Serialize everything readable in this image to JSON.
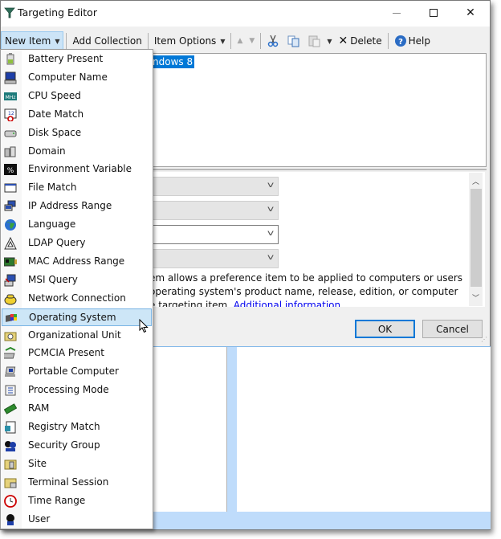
{
  "window": {
    "title": "Targeting Editor",
    "controls": {
      "minimize": "minimize",
      "maximize": "maximize",
      "close": "close"
    }
  },
  "toolbar": {
    "new_item": "New Item",
    "add_collection": "Add Collection",
    "item_options": "Item Options",
    "delete": "Delete",
    "help": "Help"
  },
  "tree": {
    "selected_item_visible_text": "ndows 8"
  },
  "properties": {
    "description_lines": [
      "em allows a preference item to be applied to computers or users",
      " operating system's product name, release, edition, or computer",
      "e targeting item. "
    ],
    "link_text": "Additional information"
  },
  "buttons": {
    "ok": "OK",
    "cancel": "Cancel"
  },
  "menu": {
    "hovered_index": 14,
    "items": [
      {
        "label": "Battery Present",
        "icon": "battery-icon"
      },
      {
        "label": "Computer Name",
        "icon": "computer-icon"
      },
      {
        "label": "CPU Speed",
        "icon": "mhz-icon"
      },
      {
        "label": "Date Match",
        "icon": "calendar-icon"
      },
      {
        "label": "Disk Space",
        "icon": "disk-icon"
      },
      {
        "label": "Domain",
        "icon": "domain-icon"
      },
      {
        "label": "Environment Variable",
        "icon": "percent-icon"
      },
      {
        "label": "File Match",
        "icon": "file-window-icon"
      },
      {
        "label": "IP Address Range",
        "icon": "network-computers-icon"
      },
      {
        "label": "Language",
        "icon": "globe-icon"
      },
      {
        "label": "LDAP Query",
        "icon": "triangle-icon"
      },
      {
        "label": "MAC Address Range",
        "icon": "network-card-icon"
      },
      {
        "label": "MSI Query",
        "icon": "msi-icon"
      },
      {
        "label": "Network Connection",
        "icon": "phone-icon"
      },
      {
        "label": "Operating System",
        "icon": "windows-icon"
      },
      {
        "label": "Organizational Unit",
        "icon": "ou-folder-icon"
      },
      {
        "label": "PCMCIA Present",
        "icon": "pcmcia-icon"
      },
      {
        "label": "Portable Computer",
        "icon": "laptop-icon"
      },
      {
        "label": "Processing Mode",
        "icon": "scroll-icon"
      },
      {
        "label": "RAM",
        "icon": "ram-icon"
      },
      {
        "label": "Registry Match",
        "icon": "registry-icon"
      },
      {
        "label": "Security Group",
        "icon": "users-icon"
      },
      {
        "label": "Site",
        "icon": "site-icon"
      },
      {
        "label": "Terminal Session",
        "icon": "terminal-folder-icon"
      },
      {
        "label": "Time Range",
        "icon": "clock-icon"
      },
      {
        "label": "User",
        "icon": "user-icon"
      }
    ]
  }
}
